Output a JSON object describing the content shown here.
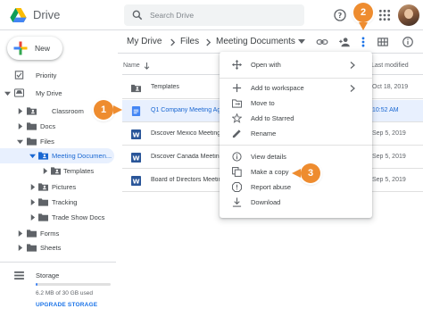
{
  "app": {
    "title": "Drive"
  },
  "search": {
    "placeholder": "Search Drive"
  },
  "header_icons": [
    "help-icon",
    "settings-icon",
    "apps-grid-icon",
    "avatar"
  ],
  "sidebar": {
    "new_label": "New",
    "items": [
      {
        "label": "Priority",
        "icon": "checkbox-icon"
      },
      {
        "label": "My Drive",
        "icon": "drive-icon"
      },
      {
        "label": "Classroom",
        "icon": "shared-folder-icon"
      },
      {
        "label": "Docs",
        "icon": "folder-icon"
      },
      {
        "label": "Files",
        "icon": "folder-icon"
      },
      {
        "label": "Meeting Documen...",
        "icon": "shared-folder-icon"
      },
      {
        "label": "Templates",
        "icon": "shared-folder-icon"
      },
      {
        "label": "Pictures",
        "icon": "shared-folder-icon"
      },
      {
        "label": "Tracking",
        "icon": "folder-icon"
      },
      {
        "label": "Trade Show Docs",
        "icon": "folder-icon"
      },
      {
        "label": "Forms",
        "icon": "folder-icon"
      },
      {
        "label": "Sheets",
        "icon": "folder-icon"
      }
    ],
    "storage": {
      "label": "Storage",
      "used_text": "6.2 MB of 30 GB used",
      "used_fraction": 0.02,
      "upgrade_label": "UPGRADE STORAGE"
    }
  },
  "breadcrumb": {
    "items": [
      "My Drive",
      "Files",
      "Meeting Documents"
    ]
  },
  "list": {
    "name_header": "Name",
    "modified_header": "Last modified",
    "rows": [
      {
        "name": "Templates",
        "type": "shared-folder-icon",
        "modified": "Oct 18, 2019",
        "selected": false
      },
      {
        "name": "Q1 Company Meeting Ag",
        "type": "doc-icon",
        "modified": "10:52 AM",
        "selected": true
      },
      {
        "name": "Discover Mexico Meeting",
        "type": "word-icon",
        "modified": "Sep 5, 2019",
        "selected": false
      },
      {
        "name": "Discover Canada Meeting",
        "type": "word-icon",
        "modified": "Sep 5, 2019",
        "selected": false
      },
      {
        "name": "Board of Directors Meeting",
        "type": "word-icon",
        "modified": "Sep 5, 2019",
        "selected": false
      }
    ]
  },
  "context_menu": {
    "items": [
      {
        "label": "Open with",
        "icon": "move-arrows-icon",
        "submenu": true
      },
      {
        "label": "Add to workspace",
        "icon": "plus-icon",
        "submenu": true
      },
      {
        "label": "Move to",
        "icon": "move-to-folder-icon",
        "submenu": false
      },
      {
        "label": "Add to Starred",
        "icon": "star-icon",
        "submenu": false
      },
      {
        "label": "Rename",
        "icon": "pencil-icon",
        "submenu": false
      },
      {
        "label": "View details",
        "icon": "info-icon",
        "submenu": false
      },
      {
        "label": "Make a copy",
        "icon": "copy-icon",
        "submenu": false
      },
      {
        "label": "Report abuse",
        "icon": "report-icon",
        "submenu": false
      },
      {
        "label": "Download",
        "icon": "download-icon",
        "submenu": false
      }
    ]
  },
  "callouts": [
    "1",
    "2",
    "3"
  ],
  "colors": {
    "accent": "#1a73e8",
    "selected_bg": "#e8f0fe",
    "callout": "#ee8c2f"
  }
}
